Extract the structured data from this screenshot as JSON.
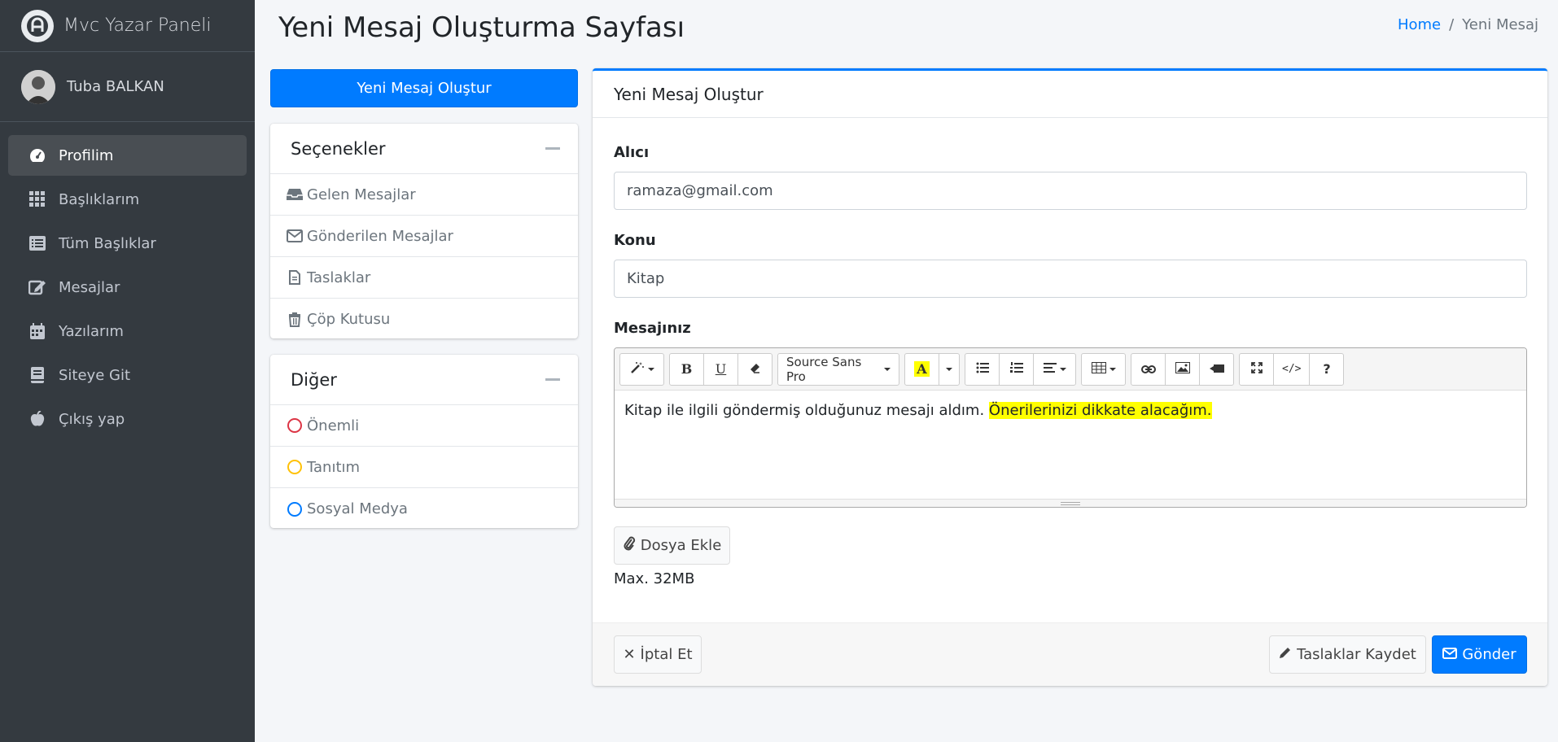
{
  "sidebar": {
    "brand": "Mvc Yazar Paneli",
    "user": "Tuba BALKAN",
    "items": [
      {
        "label": "Profilim",
        "icon": "tachometer-icon"
      },
      {
        "label": "Başlıklarım",
        "icon": "grid-icon"
      },
      {
        "label": "Tüm Başlıklar",
        "icon": "list-icon"
      },
      {
        "label": "Mesajlar",
        "icon": "edit-icon"
      },
      {
        "label": "Yazılarım",
        "icon": "calendar-icon"
      },
      {
        "label": "Siteye Git",
        "icon": "book-icon"
      },
      {
        "label": "Çıkış yap",
        "icon": "apple-icon"
      }
    ]
  },
  "header": {
    "title": "Yeni Mesaj Oluşturma Sayfası",
    "breadcrumb_home": "Home",
    "breadcrumb_sep": "/",
    "breadcrumb_current": "Yeni Mesaj"
  },
  "left": {
    "compose_label": "Yeni Mesaj Oluştur",
    "options_title": "Seçenekler",
    "options": [
      "Gelen Mesajlar",
      "Gönderilen Mesajlar",
      "Taslaklar",
      "Çöp Kutusu"
    ],
    "other_title": "Diğer",
    "other": [
      {
        "label": "Önemli",
        "color": "#dc3545"
      },
      {
        "label": "Tanıtım",
        "color": "#ffc107"
      },
      {
        "label": "Sosyal Medya",
        "color": "#007bff"
      }
    ]
  },
  "form": {
    "card_title": "Yeni Mesaj Oluştur",
    "recipient_label": "Alıcı",
    "recipient_value": "ramaza@gmail.com",
    "subject_label": "Konu",
    "subject_value": "Kitap",
    "message_label": "Mesajınız",
    "font_name": "Source Sans Pro",
    "message_plain": "Kitap ile ilgili göndermiş olduğunuz mesajı aldım. ",
    "message_highlight": "Önerilerinizi dikkate alacağım.",
    "highlight_color": "#ffff00",
    "attach_label": "Dosya Ekle",
    "max_size": "Max. 32MB",
    "cancel_label": "İptal Et",
    "draft_label": "Taslaklar Kaydet",
    "send_label": "Gönder"
  }
}
